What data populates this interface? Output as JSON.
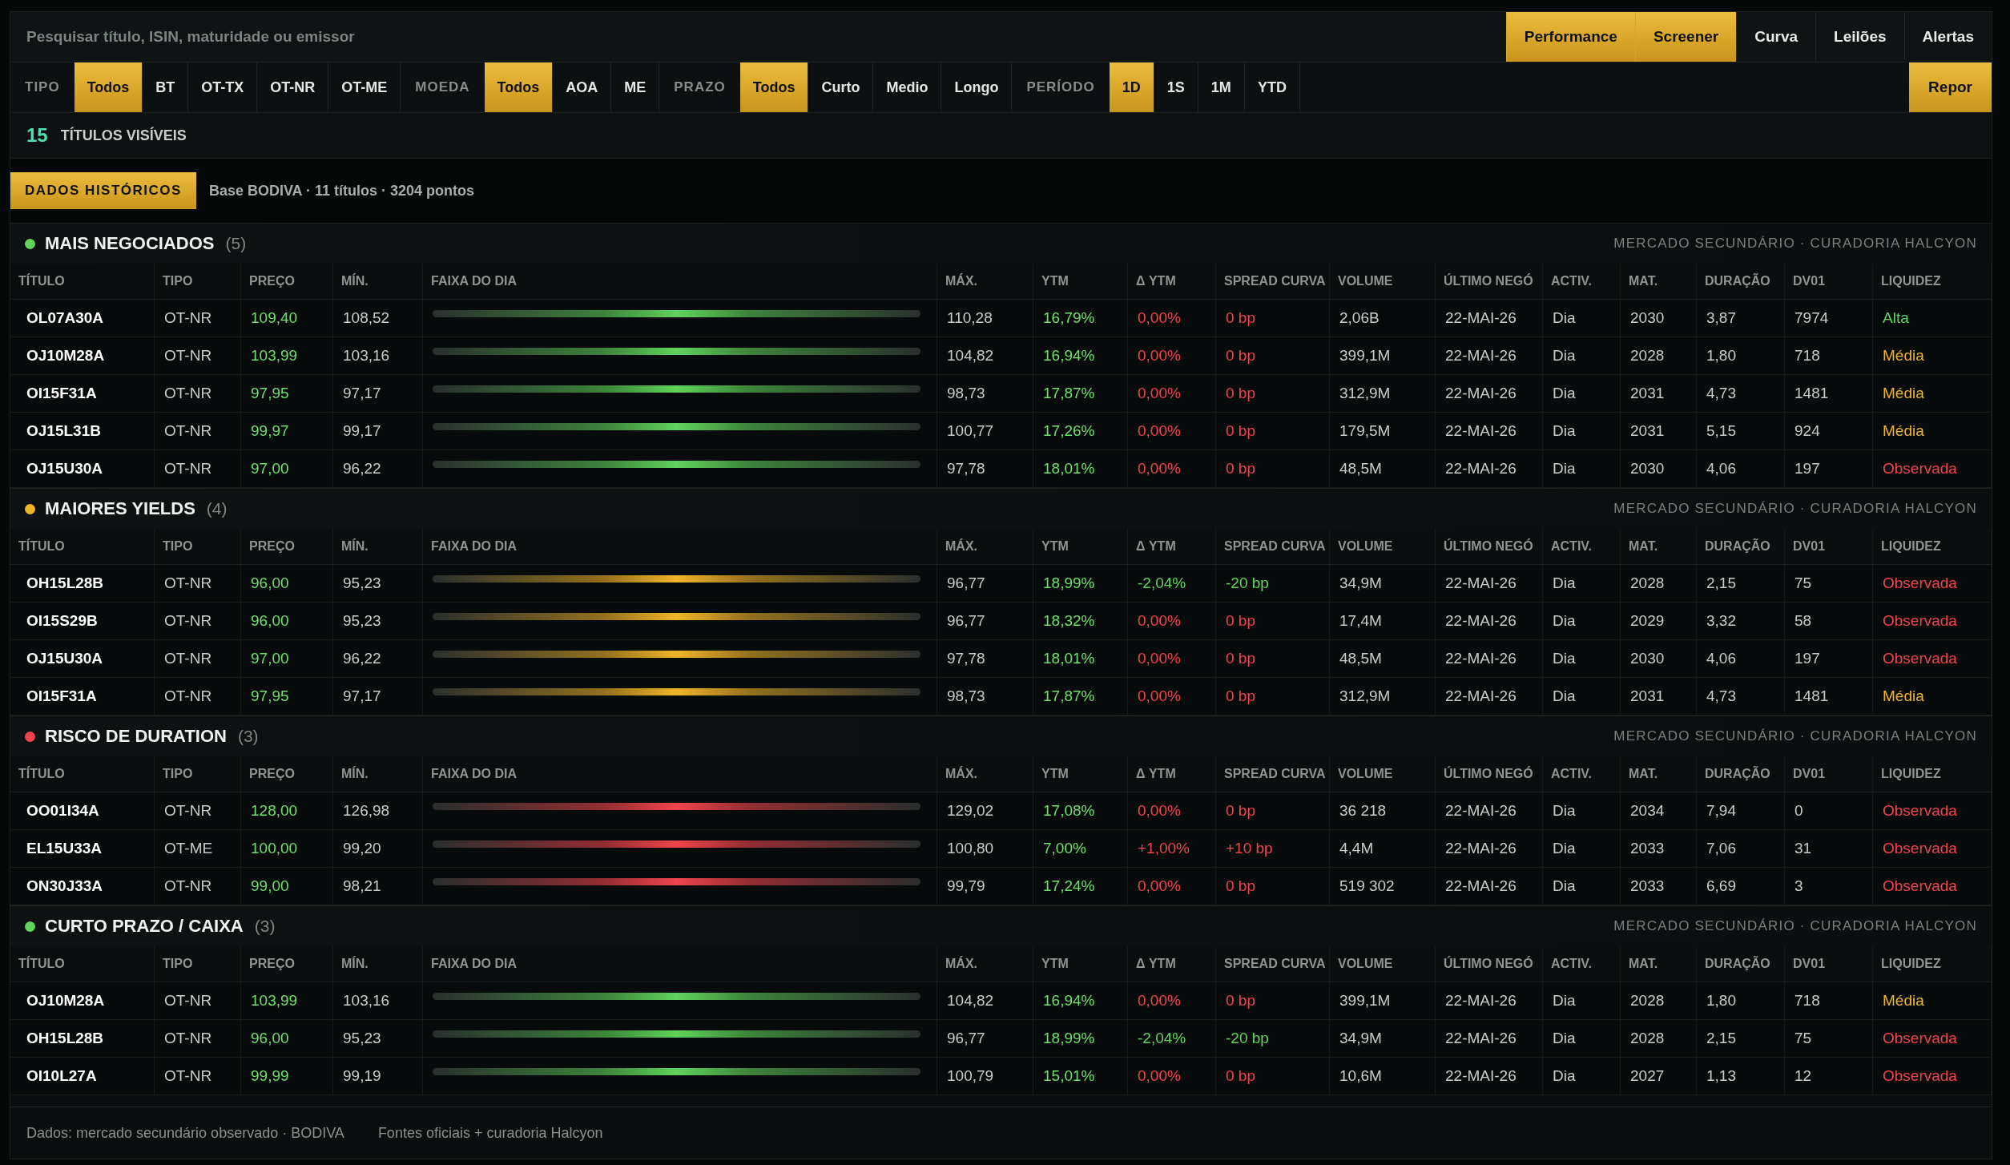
{
  "search": {
    "placeholder": "Pesquisar título, ISIN, maturidade ou emissor"
  },
  "nav_tabs": [
    {
      "label": "Performance",
      "selected": true
    },
    {
      "label": "Screener",
      "selected": true
    },
    {
      "label": "Curva",
      "selected": false
    },
    {
      "label": "Leilões",
      "selected": false
    },
    {
      "label": "Alertas",
      "selected": false
    }
  ],
  "filters": [
    {
      "label": "TIPO",
      "options": [
        {
          "label": "Todos",
          "selected": true
        },
        {
          "label": "BT",
          "selected": false
        },
        {
          "label": "OT-TX",
          "selected": false
        },
        {
          "label": "OT-NR",
          "selected": false
        },
        {
          "label": "OT-ME",
          "selected": false
        }
      ]
    },
    {
      "label": "MOEDA",
      "options": [
        {
          "label": "Todos",
          "selected": true
        },
        {
          "label": "AOA",
          "selected": false
        },
        {
          "label": "ME",
          "selected": false
        }
      ]
    },
    {
      "label": "PRAZO",
      "options": [
        {
          "label": "Todos",
          "selected": true
        },
        {
          "label": "Curto",
          "selected": false
        },
        {
          "label": "Medio",
          "selected": false
        },
        {
          "label": "Longo",
          "selected": false
        }
      ]
    },
    {
      "label": "PERÍODO",
      "options": [
        {
          "label": "1D",
          "selected": true
        },
        {
          "label": "1S",
          "selected": false
        },
        {
          "label": "1M",
          "selected": false
        },
        {
          "label": "YTD",
          "selected": false
        }
      ]
    }
  ],
  "reset_button": "Repor",
  "visible_count": {
    "count": "15",
    "label": "TÍTULOS VISÍVEIS"
  },
  "historical": {
    "badge": "DADOS HISTÓRICOS",
    "text": "Base BODIVA · 11 títulos · 3204 pontos"
  },
  "sections": [
    {
      "title": "MAIS NEGOCIADOS",
      "count": "(5)",
      "color": "#5fd35a",
      "note": "MERCADO SECUNDÁRIO · CURADORIA HALCYON",
      "columns": [
        "TÍTULO",
        "TIPO",
        "PREÇO",
        "MÍN.",
        "FAIXA DO DIA",
        "MÁX.",
        "YTM",
        "Δ YTM",
        "SPREAD CURVA",
        "VOLUME",
        "ÚLTIMO NEGÓ",
        "ACTIV.",
        "MAT.",
        "DURAÇÃO",
        "DV01",
        "LIQUIDEZ"
      ],
      "rows": [
        {
          "title": "OL07A30A",
          "type": "OT-NR",
          "price": "109,40",
          "min": "108,52",
          "max": "110,28",
          "ytm": "16,79%",
          "delta": "0,00%",
          "spread": "0 bp",
          "improved": false,
          "volume": "2,06B",
          "last_trade": "22-MAI-26",
          "activ": "Dia",
          "maturity": "2030",
          "duration": "3,87",
          "dv01": "7974",
          "liquidity": "Alta",
          "color": "#5fd35a"
        },
        {
          "title": "OJ10M28A",
          "type": "OT-NR",
          "price": "103,99",
          "min": "103,16",
          "max": "104,82",
          "ytm": "16,94%",
          "delta": "0,00%",
          "spread": "0 bp",
          "improved": false,
          "volume": "399,1M",
          "last_trade": "22-MAI-26",
          "activ": "Dia",
          "maturity": "2028",
          "duration": "1,80",
          "dv01": "718",
          "liquidity": "Média",
          "color": "#f0b429"
        },
        {
          "title": "OI15F31A",
          "type": "OT-NR",
          "price": "97,95",
          "min": "97,17",
          "max": "98,73",
          "ytm": "17,87%",
          "delta": "0,00%",
          "spread": "0 bp",
          "improved": false,
          "volume": "312,9M",
          "last_trade": "22-MAI-26",
          "activ": "Dia",
          "maturity": "2031",
          "duration": "4,73",
          "dv01": "1481",
          "liquidity": "Média",
          "color": "#f0b429"
        },
        {
          "title": "OJ15L31B",
          "type": "OT-NR",
          "price": "99,97",
          "min": "99,17",
          "max": "100,77",
          "ytm": "17,26%",
          "delta": "0,00%",
          "spread": "0 bp",
          "improved": false,
          "volume": "179,5M",
          "last_trade": "22-MAI-26",
          "activ": "Dia",
          "maturity": "2031",
          "duration": "5,15",
          "dv01": "924",
          "liquidity": "Média",
          "color": "#f0b429"
        },
        {
          "title": "OJ15U30A",
          "type": "OT-NR",
          "price": "97,00",
          "min": "96,22",
          "max": "97,78",
          "ytm": "18,01%",
          "delta": "0,00%",
          "spread": "0 bp",
          "improved": false,
          "volume": "48,5M",
          "last_trade": "22-MAI-26",
          "activ": "Dia",
          "maturity": "2030",
          "duration": "4,06",
          "dv01": "197",
          "liquidity": "Observada",
          "color": "#f0444c"
        }
      ]
    },
    {
      "title": "MAIORES YIELDS",
      "count": "(4)",
      "color": "#f0b429",
      "note": "MERCADO SECUNDÁRIO · CURADORIA HALCYON",
      "columns": [
        "TÍTULO",
        "TIPO",
        "PREÇO",
        "MÍN.",
        "FAIXA DO DIA",
        "MÁX.",
        "YTM",
        "Δ YTM",
        "SPREAD CURVA",
        "VOLUME",
        "ÚLTIMO NEGÓ",
        "ACTIV.",
        "MAT.",
        "DURAÇÃO",
        "DV01",
        "LIQUIDEZ"
      ],
      "rows": [
        {
          "title": "OH15L28B",
          "type": "OT-NR",
          "price": "96,00",
          "min": "95,23",
          "max": "96,77",
          "ytm": "18,99%",
          "delta": "-2,04%",
          "spread": "-20 bp",
          "improved": true,
          "volume": "34,9M",
          "last_trade": "22-MAI-26",
          "activ": "Dia",
          "maturity": "2028",
          "duration": "2,15",
          "dv01": "75",
          "liquidity": "Observada",
          "color": "#f0444c"
        },
        {
          "title": "OI15S29B",
          "type": "OT-NR",
          "price": "96,00",
          "min": "95,23",
          "max": "96,77",
          "ytm": "18,32%",
          "delta": "0,00%",
          "spread": "0 bp",
          "improved": false,
          "volume": "17,4M",
          "last_trade": "22-MAI-26",
          "activ": "Dia",
          "maturity": "2029",
          "duration": "3,32",
          "dv01": "58",
          "liquidity": "Observada",
          "color": "#f0444c"
        },
        {
          "title": "OJ15U30A",
          "type": "OT-NR",
          "price": "97,00",
          "min": "96,22",
          "max": "97,78",
          "ytm": "18,01%",
          "delta": "0,00%",
          "spread": "0 bp",
          "improved": false,
          "volume": "48,5M",
          "last_trade": "22-MAI-26",
          "activ": "Dia",
          "maturity": "2030",
          "duration": "4,06",
          "dv01": "197",
          "liquidity": "Observada",
          "color": "#f0444c"
        },
        {
          "title": "OI15F31A",
          "type": "OT-NR",
          "price": "97,95",
          "min": "97,17",
          "max": "98,73",
          "ytm": "17,87%",
          "delta": "0,00%",
          "spread": "0 bp",
          "improved": false,
          "volume": "312,9M",
          "last_trade": "22-MAI-26",
          "activ": "Dia",
          "maturity": "2031",
          "duration": "4,73",
          "dv01": "1481",
          "liquidity": "Média",
          "color": "#f0b429"
        }
      ]
    },
    {
      "title": "RISCO DE DURATION",
      "count": "(3)",
      "color": "#f0444c",
      "note": "MERCADO SECUNDÁRIO · CURADORIA HALCYON",
      "columns": [
        "TÍTULO",
        "TIPO",
        "PREÇO",
        "MÍN.",
        "FAIXA DO DIA",
        "MÁX.",
        "YTM",
        "Δ YTM",
        "SPREAD CURVA",
        "VOLUME",
        "ÚLTIMO NEGÓ",
        "ACTIV.",
        "MAT.",
        "DURAÇÃO",
        "DV01",
        "LIQUIDEZ"
      ],
      "rows": [
        {
          "title": "OO01I34A",
          "type": "OT-NR",
          "price": "128,00",
          "min": "126,98",
          "max": "129,02",
          "ytm": "17,08%",
          "delta": "0,00%",
          "spread": "0 bp",
          "improved": false,
          "volume": "36 218",
          "last_trade": "22-MAI-26",
          "activ": "Dia",
          "maturity": "2034",
          "duration": "7,94",
          "dv01": "0",
          "liquidity": "Observada",
          "color": "#f0444c"
        },
        {
          "title": "EL15U33A",
          "type": "OT-ME",
          "price": "100,00",
          "min": "99,20",
          "max": "100,80",
          "ytm": "7,00%",
          "delta": "+1,00%",
          "spread": "+10 bp",
          "improved": false,
          "volume": "4,4M",
          "last_trade": "22-MAI-26",
          "activ": "Dia",
          "maturity": "2033",
          "duration": "7,06",
          "dv01": "31",
          "liquidity": "Observada",
          "color": "#f0444c"
        },
        {
          "title": "ON30J33A",
          "type": "OT-NR",
          "price": "99,00",
          "min": "98,21",
          "max": "99,79",
          "ytm": "17,24%",
          "delta": "0,00%",
          "spread": "0 bp",
          "improved": false,
          "volume": "519 302",
          "last_trade": "22-MAI-26",
          "activ": "Dia",
          "maturity": "2033",
          "duration": "6,69",
          "dv01": "3",
          "liquidity": "Observada",
          "color": "#f0444c"
        }
      ]
    },
    {
      "title": "CURTO PRAZO / CAIXA",
      "count": "(3)",
      "color": "#5fd35a",
      "note": "MERCADO SECUNDÁRIO · CURADORIA HALCYON",
      "columns": [
        "TÍTULO",
        "TIPO",
        "PREÇO",
        "MÍN.",
        "FAIXA DO DIA",
        "MÁX.",
        "YTM",
        "Δ YTM",
        "SPREAD CURVA",
        "VOLUME",
        "ÚLTIMO NEGÓ",
        "ACTIV.",
        "MAT.",
        "DURAÇÃO",
        "DV01",
        "LIQUIDEZ"
      ],
      "rows": [
        {
          "title": "OJ10M28A",
          "type": "OT-NR",
          "price": "103,99",
          "min": "103,16",
          "max": "104,82",
          "ytm": "16,94%",
          "delta": "0,00%",
          "spread": "0 bp",
          "improved": false,
          "volume": "399,1M",
          "last_trade": "22-MAI-26",
          "activ": "Dia",
          "maturity": "2028",
          "duration": "1,80",
          "dv01": "718",
          "liquidity": "Média",
          "color": "#f0b429"
        },
        {
          "title": "OH15L28B",
          "type": "OT-NR",
          "price": "96,00",
          "min": "95,23",
          "max": "96,77",
          "ytm": "18,99%",
          "delta": "-2,04%",
          "spread": "-20 bp",
          "improved": true,
          "volume": "34,9M",
          "last_trade": "22-MAI-26",
          "activ": "Dia",
          "maturity": "2028",
          "duration": "2,15",
          "dv01": "75",
          "liquidity": "Observada",
          "color": "#f0444c"
        },
        {
          "title": "OI10L27A",
          "type": "OT-NR",
          "price": "99,99",
          "min": "99,19",
          "max": "100,79",
          "ytm": "15,01%",
          "delta": "0,00%",
          "spread": "0 bp",
          "improved": false,
          "volume": "10,6M",
          "last_trade": "22-MAI-26",
          "activ": "Dia",
          "maturity": "2027",
          "duration": "1,13",
          "dv01": "12",
          "liquidity": "Observada",
          "color": "#f0444c"
        }
      ]
    }
  ],
  "footer": [
    "Dados: mercado secundário observado · BODIVA",
    "Fontes oficiais + curadoria Halcyon"
  ]
}
